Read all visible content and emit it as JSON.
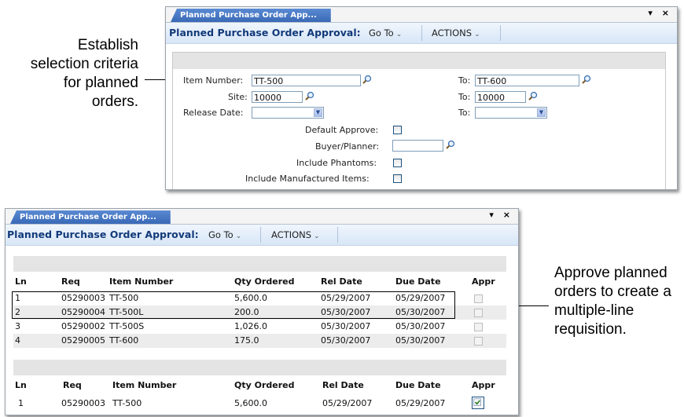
{
  "callouts": {
    "left_lines": [
      "Establish",
      "selection criteria",
      "for planned",
      "orders."
    ],
    "right_lines": [
      "Approve planned",
      "orders to create a",
      "multiple-line",
      "requisition."
    ]
  },
  "top_window": {
    "tab_label": "Planned Purchase Order App...",
    "controls": "▾ ×",
    "menubar": {
      "title": "Planned Purchase Order Approval:",
      "goto": "Go To",
      "actions": "ACTIONS"
    },
    "form": {
      "item_number_label": "Item Number:",
      "item_number_value": "TT-500",
      "item_to_label": "To:",
      "item_to_value": "TT-600",
      "site_label": "Site:",
      "site_value": "10000",
      "site_to_label": "To:",
      "site_to_value": "10000",
      "release_date_label": "Release Date:",
      "release_to_label": "To:",
      "default_approve_label": "Default Approve:",
      "buyer_planner_label": "Buyer/Planner:",
      "include_phantoms_label": "Include Phantoms:",
      "include_manufactured_label": "Include Manufactured Items:"
    }
  },
  "bottom_window": {
    "tab_label": "Planned Purchase Order App...",
    "controls": "▾ ×",
    "menubar": {
      "title": "Planned Purchase Order Approval:",
      "goto": "Go To",
      "actions": "ACTIONS"
    },
    "table1": {
      "headers": [
        "Ln",
        "Req",
        "Item Number",
        "Qty Ordered",
        "Rel Date",
        "Due Date",
        "Appr"
      ],
      "rows": [
        [
          "1",
          "05290003",
          "TT-500",
          "5,600.0",
          "05/29/2007",
          "05/29/2007"
        ],
        [
          "2",
          "05290004",
          "TT-500L",
          "200.0",
          "05/30/2007",
          "05/30/2007"
        ],
        [
          "3",
          "05290002",
          "TT-500S",
          "1,026.0",
          "05/30/2007",
          "05/30/2007"
        ],
        [
          "4",
          "05290005",
          "TT-600",
          "175.0",
          "05/30/2007",
          "05/30/2007"
        ]
      ]
    },
    "table2": {
      "headers": [
        "Ln",
        "Req",
        "Item Number",
        "Qty Ordered",
        "Rel Date",
        "Due Date",
        "Appr"
      ],
      "rows": [
        [
          "1",
          "05290003",
          "TT-500",
          "5,600.0",
          "05/29/2007",
          "05/29/2007"
        ]
      ]
    }
  }
}
